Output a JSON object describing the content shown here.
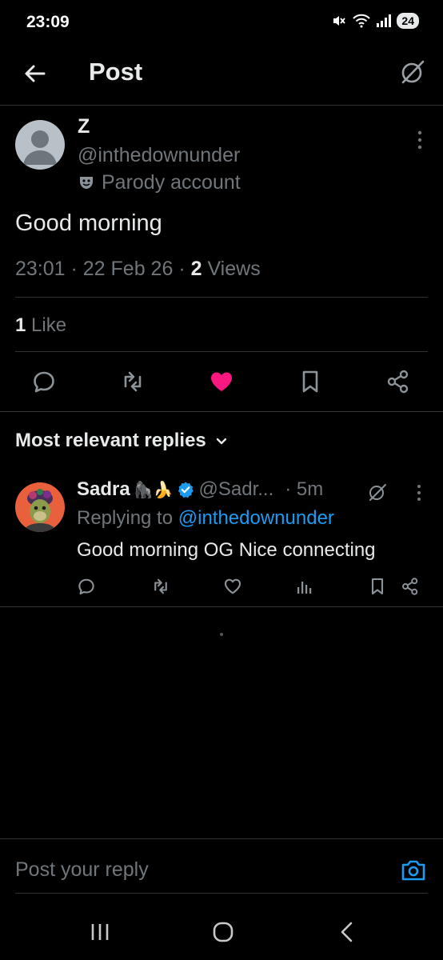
{
  "status_bar": {
    "time": "23:09",
    "battery": "24",
    "icons": [
      "mute-icon",
      "wifi-icon",
      "signal-icon",
      "battery-icon"
    ]
  },
  "header": {
    "title": "Post",
    "back_icon": "arrow-left-icon",
    "grok_icon": "grok-icon"
  },
  "post": {
    "author_name": "Z",
    "author_handle": "@inthedownunder",
    "parody_label": "Parody account",
    "text": "Good morning",
    "time": "23:01",
    "date": "22 Feb 26",
    "views_count": "2",
    "views_label": "Views",
    "likes_count": "1",
    "likes_label": "Like",
    "liked": true,
    "like_color": "#f91880",
    "actions": [
      "reply-icon",
      "repost-icon",
      "heart-icon",
      "bookmark-icon",
      "share-icon"
    ]
  },
  "replies": {
    "heading": "Most relevant replies",
    "items": [
      {
        "name": "Sadra",
        "emoji": "🦍🍌",
        "verified": true,
        "handle": "@Sadr...",
        "time": "· 5m",
        "replying_prefix": "Replying to",
        "replying_to": "@inthedownunder",
        "text": "Good morning OG Nice connecting"
      }
    ]
  },
  "composer": {
    "placeholder": "Post your reply",
    "camera_icon": "camera-icon"
  },
  "colors": {
    "background": "#000000",
    "text": "#e7e9ea",
    "secondary": "#71767b",
    "accent": "#1d9bf0",
    "like": "#f91880",
    "divider": "#2f3336"
  },
  "nav": [
    "recents-icon",
    "home-icon",
    "back-icon"
  ]
}
